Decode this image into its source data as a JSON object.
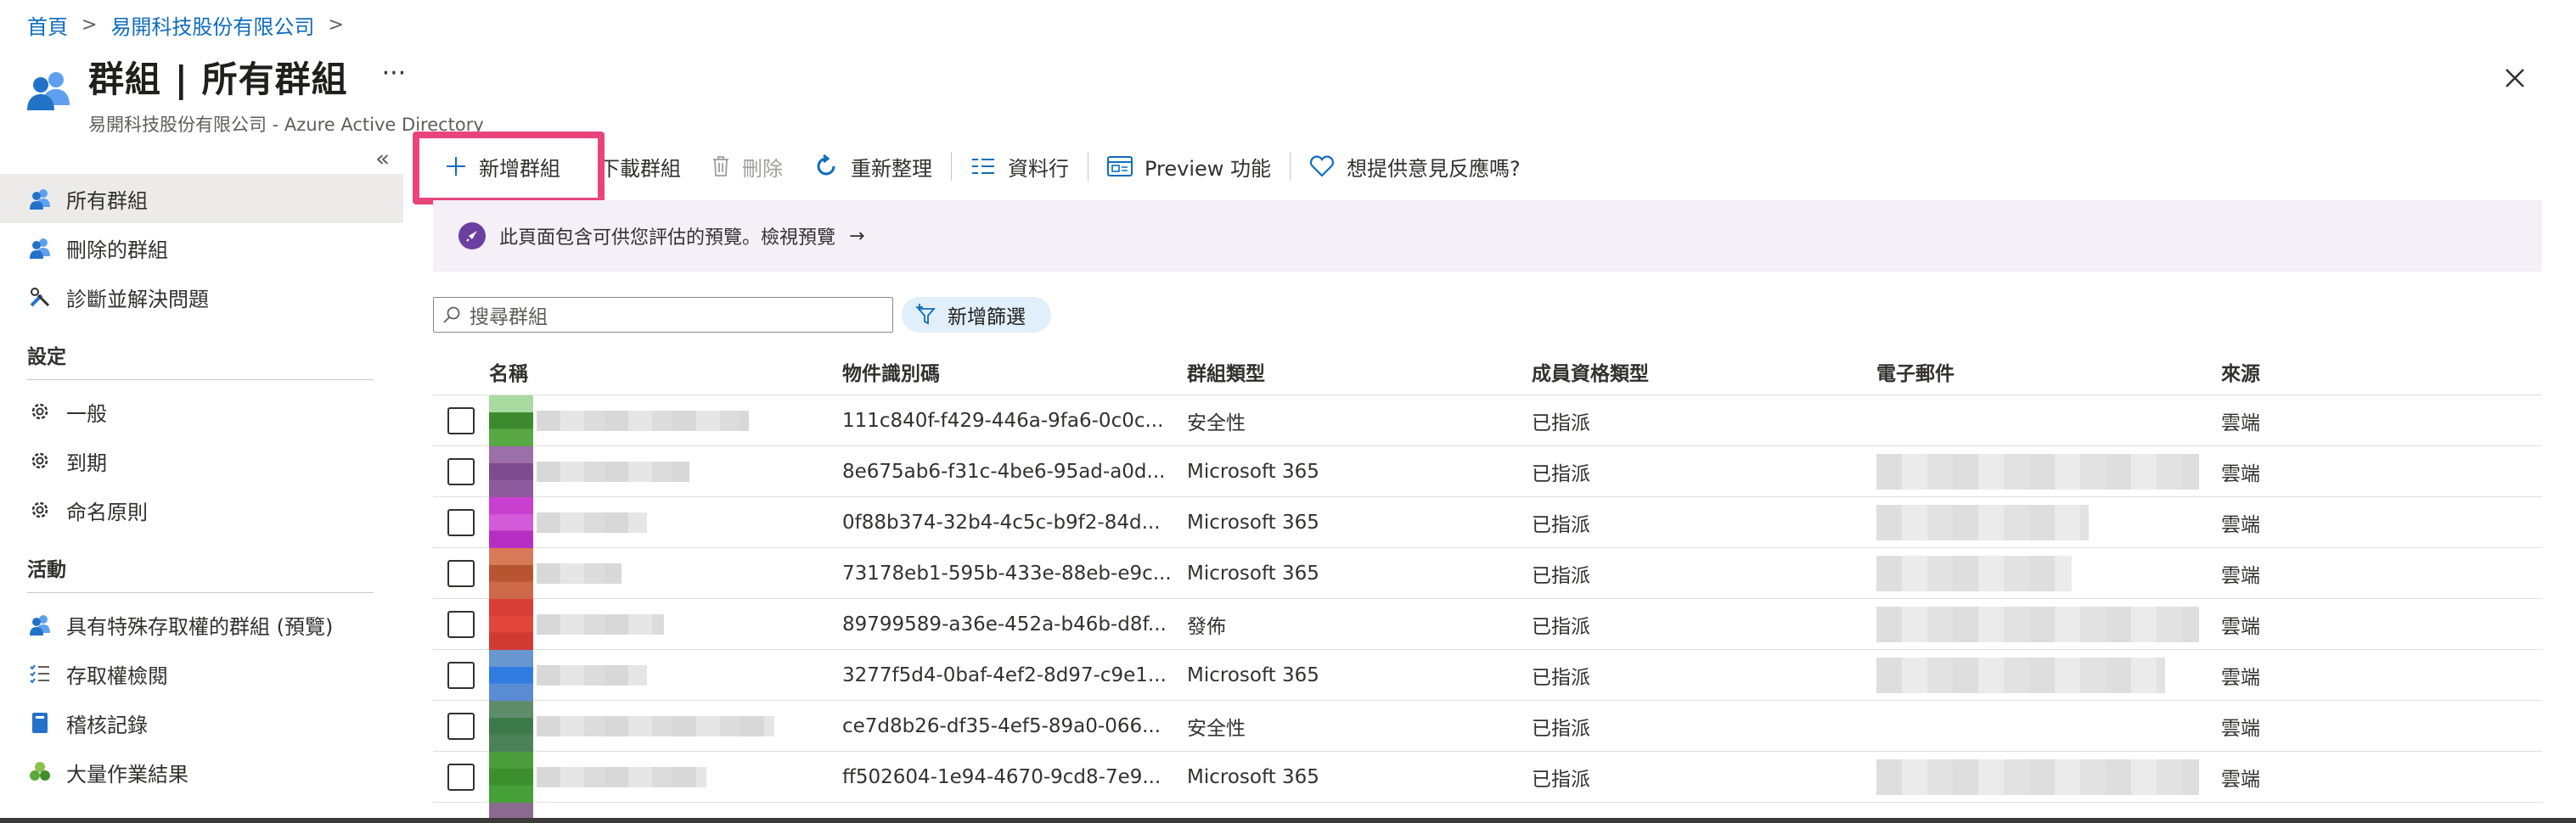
{
  "breadcrumb": {
    "home": "首頁",
    "org": "易開科技股份有限公司",
    "sep": ">"
  },
  "header": {
    "title": "群組 | 所有群組",
    "subtitle": "易開科技股份有限公司 - Azure Active Directory",
    "more": "···"
  },
  "sidebar": {
    "collapse": "«",
    "items": [
      {
        "label": "所有群組",
        "icon": "group-icon"
      },
      {
        "label": "刪除的群組",
        "icon": "group-icon"
      },
      {
        "label": "診斷並解決問題",
        "icon": "wrench-icon"
      }
    ],
    "sections": [
      {
        "title": "設定",
        "items": [
          {
            "label": "一般",
            "icon": "gear-icon"
          },
          {
            "label": "到期",
            "icon": "gear-icon"
          },
          {
            "label": "命名原則",
            "icon": "gear-icon"
          }
        ]
      },
      {
        "title": "活動",
        "items": [
          {
            "label": "具有特殊存取權的群組 (預覽)",
            "icon": "group-icon"
          },
          {
            "label": "存取權檢閱",
            "icon": "checklist-icon"
          },
          {
            "label": "稽核記錄",
            "icon": "book-icon"
          },
          {
            "label": "大量作業結果",
            "icon": "clover-icon"
          }
        ]
      }
    ]
  },
  "toolbar": {
    "new_group": "新增群組",
    "download": "下載群組",
    "delete": "刪除",
    "refresh": "重新整理",
    "columns": "資料行",
    "preview": "Preview 功能",
    "feedback": "想提供意見反應嗎?"
  },
  "banner": {
    "text": "此頁面包含可供您評估的預覽。檢視預覽",
    "arrow": "→"
  },
  "search": {
    "placeholder": "搜尋群組"
  },
  "filter": {
    "label": "新增篩選"
  },
  "table": {
    "headers": {
      "name": "名稱",
      "id": "物件識別碼",
      "type": "群組類型",
      "member": "成員資格類型",
      "email": "電子郵件",
      "source": "來源"
    },
    "rows": [
      {
        "id": "111c840f-f429-446a-9fa6-0c0c...",
        "type": "安全性",
        "member": "已指派",
        "source": "雲端",
        "avatar": [
          "#a9dba0",
          "#3c8a2e",
          "#57a843"
        ],
        "has_email": false
      },
      {
        "id": "8e675ab6-f31c-4be6-95ad-a0d...",
        "type": "Microsoft 365",
        "member": "已指派",
        "source": "雲端",
        "avatar": [
          "#9b6fa8",
          "#7e4b8e",
          "#8d5a9c"
        ],
        "has_email": true
      },
      {
        "id": "0f88b374-32b4-4c5c-b9f2-84d...",
        "type": "Microsoft 365",
        "member": "已指派",
        "source": "雲端",
        "avatar": [
          "#c93fd0",
          "#d35ad8",
          "#b72fc2"
        ],
        "has_email": true
      },
      {
        "id": "73178eb1-595b-433e-88eb-e9c...",
        "type": "Microsoft 365",
        "member": "已指派",
        "source": "雲端",
        "avatar": [
          "#d87a58",
          "#b85430",
          "#cd6848"
        ],
        "has_email": true
      },
      {
        "id": "89799589-a36e-452a-b46b-d8f...",
        "type": "發佈",
        "member": "已指派",
        "source": "雲端",
        "avatar": [
          "#d83d36",
          "#e2453c",
          "#cf3b33"
        ],
        "has_email": true
      },
      {
        "id": "3277f5d4-0baf-4ef2-8d97-c9e1...",
        "type": "Microsoft 365",
        "member": "已指派",
        "source": "雲端",
        "avatar": [
          "#6896d0",
          "#2f7de0",
          "#5a8cd4"
        ],
        "has_email": true
      },
      {
        "id": "ce7d8b26-df35-4ef5-89a0-066...",
        "type": "安全性",
        "member": "已指派",
        "source": "雲端",
        "avatar": [
          "#5f8c6a",
          "#3d7a4b",
          "#4d8258"
        ],
        "has_email": false
      },
      {
        "id": "ff502604-1e94-4670-9cd8-7e9...",
        "type": "Microsoft 365",
        "member": "已指派",
        "source": "雲端",
        "avatar": [
          "#4b9c3a",
          "#3c8f2c",
          "#45a038"
        ],
        "has_email": true
      }
    ]
  }
}
